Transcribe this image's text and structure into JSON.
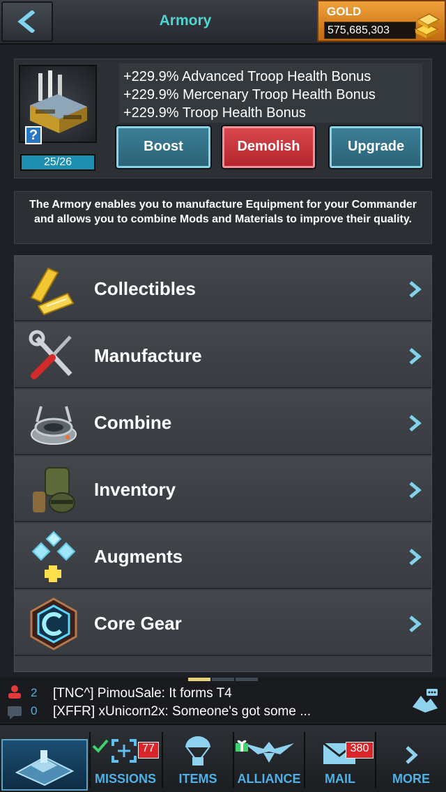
{
  "header": {
    "title": "Armory",
    "gold_label": "GOLD",
    "gold_value": "575,685,303"
  },
  "building": {
    "level": "25/26",
    "help_glyph": "?",
    "bonuses": [
      "+229.9% Advanced Troop Health Bonus",
      "+229.9% Mercenary Troop Health Bonus",
      "+229.9% Troop Health Bonus"
    ],
    "actions": {
      "boost": "Boost",
      "demolish": "Demolish",
      "upgrade": "Upgrade"
    }
  },
  "description": "The Armory enables you to manufacture Equipment for your Commander and allows you to combine Mods and Materials to improve their quality.",
  "menu": [
    {
      "label": "Collectibles",
      "icon": "tickets-icon"
    },
    {
      "label": "Manufacture",
      "icon": "tools-icon"
    },
    {
      "label": "Combine",
      "icon": "combine-device-icon"
    },
    {
      "label": "Inventory",
      "icon": "gear-backpack-icon"
    },
    {
      "label": "Augments",
      "icon": "augment-diamonds-icon"
    },
    {
      "label": "Core Gear",
      "icon": "core-gear-hex-icon"
    }
  ],
  "chat": {
    "alliance_count": "2",
    "message_count": "0",
    "messages": [
      "[TNC^] PimouSale: It forms T4",
      "[XFFR] xUnicorn2x: Someone's got some ..."
    ]
  },
  "nav": {
    "missions": {
      "label": "MISSIONS",
      "badge": "77"
    },
    "items": {
      "label": "ITEMS"
    },
    "alliance": {
      "label": "ALLIANCE"
    },
    "mail": {
      "label": "MAIL",
      "badge": "380"
    },
    "more": {
      "label": "MORE"
    }
  },
  "colors": {
    "accent": "#4fd6d1",
    "nav_blue": "#4fb0e6",
    "demolish_red": "#d8484e",
    "gold": "#f0a13a"
  }
}
